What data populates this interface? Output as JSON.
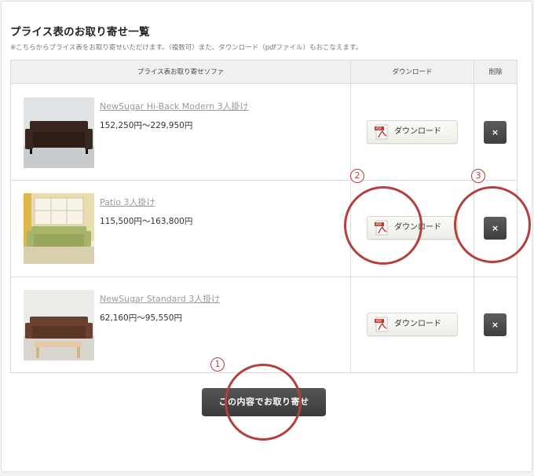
{
  "page": {
    "title": "プライス表のお取り寄せ一覧",
    "note": "※こちらからプライス表をお取り寄せいただけます。（複数可）また、ダウンロード（pdfファイル）もおこなえます。"
  },
  "table": {
    "headers": {
      "product": "プライス表お取り寄せソファ",
      "download": "ダウンロード",
      "delete": "削除"
    },
    "rows": [
      {
        "name": "NewSugar Hi-Back Modern 3人掛け",
        "price": "152,250円〜229,950円",
        "download_label": "ダウンロード",
        "delete_label": "×"
      },
      {
        "name": "Patio 3人掛け",
        "price": "115,500円〜163,800円",
        "download_label": "ダウンロード",
        "delete_label": "×"
      },
      {
        "name": "NewSugar Standard 3人掛け",
        "price": "62,160円〜95,550円",
        "download_label": "ダウンロード",
        "delete_label": "×"
      }
    ]
  },
  "submit_label": "この内容でお取り寄せ",
  "callouts": [
    "1",
    "2",
    "3"
  ],
  "colors": {
    "callout": "#b0413e",
    "button_dark": "#444444",
    "pdf_red": "#c0392b"
  }
}
